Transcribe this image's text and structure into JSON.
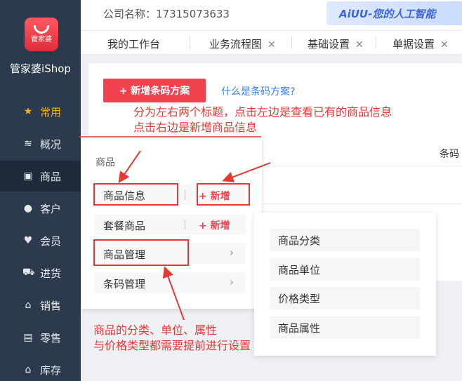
{
  "sidebar": {
    "logo_text": "管家婆",
    "brand": "管家婆iShop",
    "items": [
      {
        "label": "常用",
        "icon": "star-icon"
      },
      {
        "label": "概况",
        "icon": "layers-icon"
      },
      {
        "label": "商品",
        "icon": "box-icon"
      },
      {
        "label": "客户",
        "icon": "user-icon"
      },
      {
        "label": "会员",
        "icon": "heart-icon"
      },
      {
        "label": "进货",
        "icon": "cart-icon"
      },
      {
        "label": "销售",
        "icon": "basket-icon"
      },
      {
        "label": "零售",
        "icon": "register-icon"
      },
      {
        "label": "库存",
        "icon": "warehouse-icon"
      }
    ]
  },
  "header": {
    "company": "公司名称：17315073633",
    "banner": "AiUU-您的人工智能"
  },
  "tabs": [
    {
      "label": "我的工作台"
    },
    {
      "label": "业务流程图"
    },
    {
      "label": "基础设置"
    },
    {
      "label": "单据设置"
    }
  ],
  "main": {
    "add_button": "+ 新增条码方案",
    "help_link": "什么是条码方案?",
    "column_header": "条码"
  },
  "dropdown": {
    "title": "商品",
    "rows": [
      {
        "label": "商品信息",
        "action": "+ 新增"
      },
      {
        "label": "套餐商品",
        "action": "+ 新增"
      },
      {
        "label": "商品管理"
      },
      {
        "label": "条码管理"
      }
    ]
  },
  "submenu": {
    "items": [
      "商品分类",
      "商品单位",
      "价格类型",
      "商品属性"
    ]
  },
  "annotations": {
    "top_line1": "分为左右两个标题，点击左边是查看已有的商品信息",
    "top_line2": "点击右边是新增商品信息",
    "bottom_line1": "商品的分类、单位、属性",
    "bottom_line2": "与价格类型都需要提前进行设置"
  },
  "colors": {
    "sidebar": "#2b3a4d",
    "accent": "#f0434f",
    "annotation": "#e53935",
    "link": "#3b82e6",
    "active_nav": "#f7b01a"
  }
}
